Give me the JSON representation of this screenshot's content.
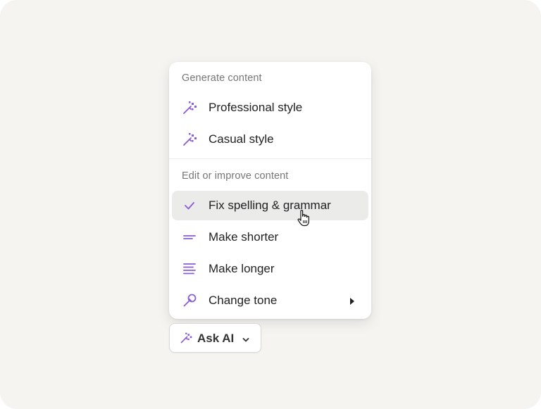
{
  "colors": {
    "accent": "#8a5cd6",
    "background": "#f5f4f1",
    "hover": "#ebebea"
  },
  "menu": {
    "sections": [
      {
        "header": "Generate content",
        "items": [
          {
            "label": "Professional style",
            "icon": "magic-wand-icon"
          },
          {
            "label": "Casual style",
            "icon": "magic-wand-icon"
          }
        ]
      },
      {
        "header": "Edit or improve content",
        "items": [
          {
            "label": "Fix spelling & grammar",
            "icon": "check-icon",
            "hovered": true
          },
          {
            "label": "Make shorter",
            "icon": "short-lines-icon"
          },
          {
            "label": "Make longer",
            "icon": "long-lines-icon"
          },
          {
            "label": "Change tone",
            "icon": "microphone-icon",
            "submenu": true
          }
        ]
      }
    ]
  },
  "ask_ai_button": {
    "label": "Ask AI",
    "icon": "magic-wand-icon",
    "dropdown_icon": "chevron-down-icon"
  }
}
